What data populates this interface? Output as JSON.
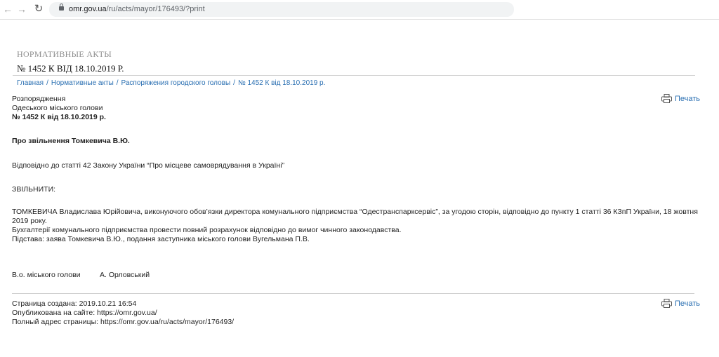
{
  "browser": {
    "url_host": "omr.gov.ua",
    "url_path": "/ru/acts/mayor/176493/?print"
  },
  "page": {
    "section_title": "НОРМАТИВНЫЕ АКТЫ",
    "doc_title": "№ 1452 К ВІД 18.10.2019 Р."
  },
  "breadcrumb": {
    "items": [
      "Главная",
      "Нормативные акты",
      "Распоряжения городского головы",
      "№ 1452 К від 18.10.2019 р."
    ],
    "separator": "/"
  },
  "print": {
    "label": "Печать"
  },
  "document": {
    "type_line1": "Розпорядження",
    "type_line2": "Одеського міського голови",
    "number": "№ 1452 К від 18.10.2019 р.",
    "subject": "Про звільнення Томкевича В.Ю.",
    "basis": "Відповідно до статті 42 Закону України “Про місцеве самоврядування в Україні”",
    "order": "ЗВІЛЬНИТИ:",
    "body": [
      "ТОМКЕВИЧА Владислава Юрійовича, виконуючого обов’язки директора комунального підприємства “Одестранспарксервіс”, за угодою сторін, відповідно до пункту 1 статті 36 КЗпП України, 18 жовтня 2019 року.",
      "Бухгалтерії комунального підприємства провести повний розрахунок відповідно до вимог чинного законодавства.",
      "Підстава: заява Томкевича В.Ю., подання заступника міського голови Вугельмана П.В."
    ],
    "signature_title": "В.о. міського голови",
    "signature_name": "А. Орловський"
  },
  "footer": {
    "created": "Страница создана: 2019.10.21 16:54",
    "published": "Опубликована на сайте: https://omr.gov.ua/",
    "address": "Полный адрес страницы: https://omr.gov.ua/ru/acts/mayor/176493/"
  }
}
